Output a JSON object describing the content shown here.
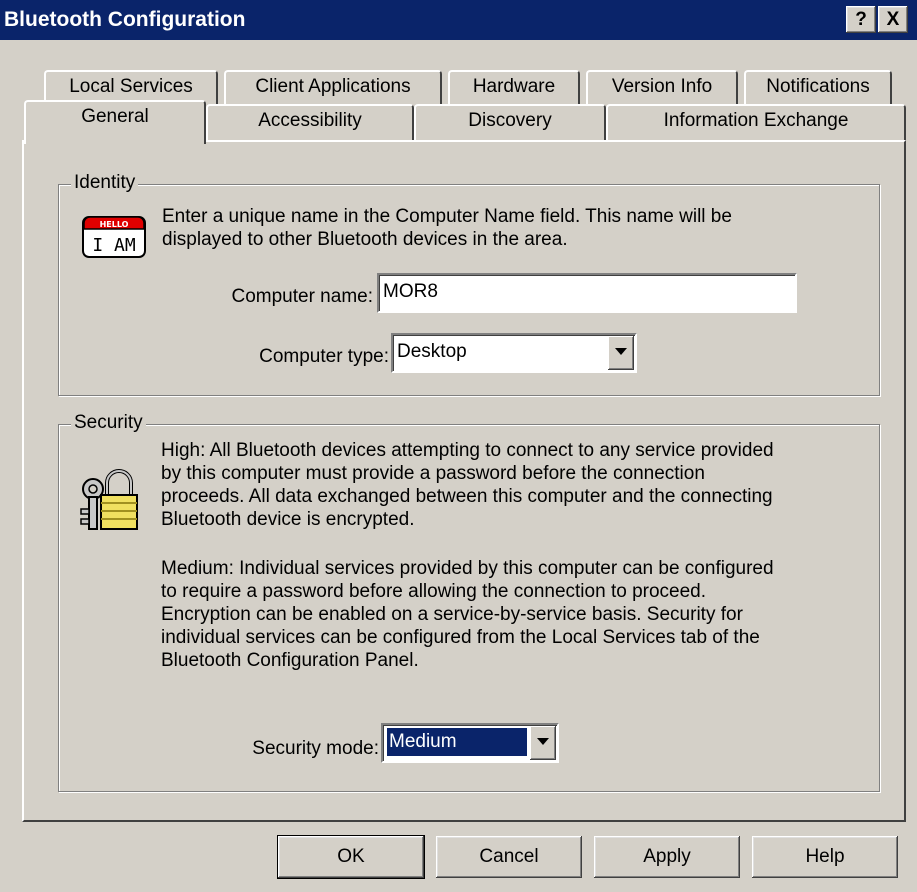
{
  "window": {
    "title": "Bluetooth Configuration",
    "help_glyph": "?",
    "close_glyph": "X"
  },
  "tabs": {
    "back_row": [
      "Local Services",
      "Client Applications",
      "Hardware",
      "Version Info",
      "Notifications"
    ],
    "front_row": [
      "General",
      "Accessibility",
      "Discovery",
      "Information Exchange"
    ],
    "active": "General"
  },
  "identity": {
    "group_label": "Identity",
    "icon": "hello-i-am-icon",
    "icon_small_text": "HELLO",
    "icon_big_text": "I AM",
    "description_line1": "Enter a unique name in the Computer Name field. This name will be",
    "description_line2": "displayed to other Bluetooth devices in the area.",
    "computer_name_label": "Computer name:",
    "computer_name_value": "MOR8",
    "computer_type_label": "Computer type:",
    "computer_type_value": "Desktop"
  },
  "security": {
    "group_label": "Security",
    "icon": "keys-padlock-icon",
    "high_lines": [
      "High: All Bluetooth devices attempting to connect to any service provided",
      "by this computer must provide a password before the connection",
      "proceeds. All data exchanged between this computer and the connecting",
      "Bluetooth device is encrypted."
    ],
    "medium_lines": [
      "Medium: Individual services provided by this computer can be configured",
      "to require a password before allowing the connection to proceed.",
      "Encryption can be enabled on a service-by-service basis. Security for",
      "individual services can be configured from the Local Services tab of the",
      "Bluetooth Configuration Panel."
    ],
    "mode_label": "Security mode:",
    "mode_value": "Medium"
  },
  "buttons": {
    "ok": "OK",
    "cancel": "Cancel",
    "apply": "Apply",
    "help": "Help"
  },
  "colors": {
    "title_bar": "#0a246a",
    "face": "#d4d0c8",
    "selection": "#0a246a"
  }
}
